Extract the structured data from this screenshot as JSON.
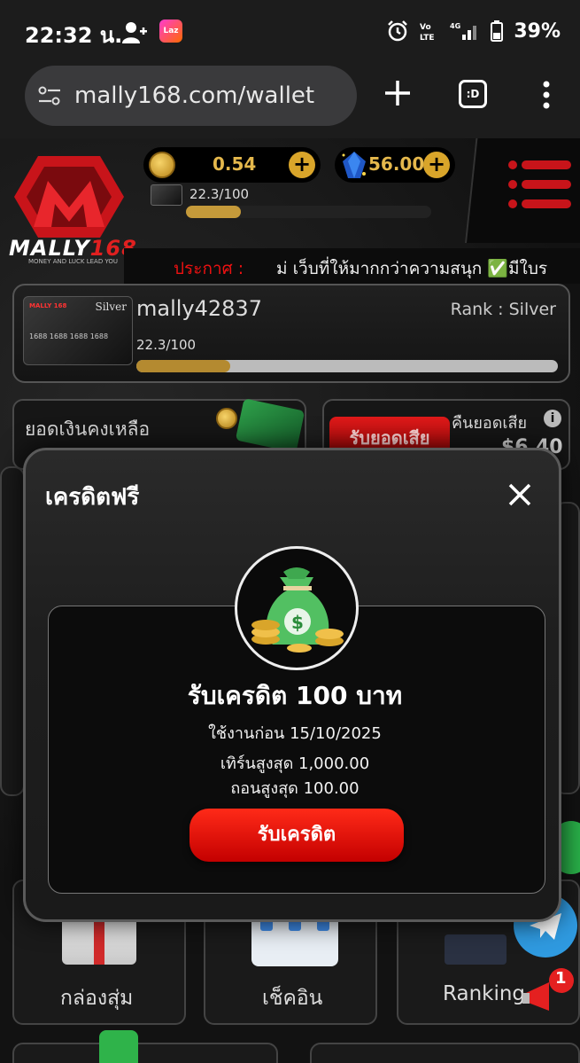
{
  "status_bar": {
    "time": "22:32 น.",
    "battery": "39%",
    "laz_badge": "Laz"
  },
  "browser": {
    "url": "mally168.com/wallet",
    "tab_icon_label": ":D"
  },
  "header": {
    "logo_text_main": "MALLY",
    "logo_text_num": "168",
    "logo_tagline": "MONEY AND LUCK LEAD YOU",
    "coin_balance": "0.54",
    "gem_balance": "56.00",
    "xp_text": "22.3/100",
    "xp_progress": 0.223,
    "announce_label": "ประกาศ :",
    "announce_text": "ม่ เว็บที่ให้มากกว่าความสนุก ✅มีใบร"
  },
  "profile": {
    "card_label": "Silver",
    "card_brand": "MALLY 168",
    "card_numbers": "1688  1688  1688  1688",
    "username": "mally42837",
    "rank": "Rank : Silver",
    "xp_text": "22.3/100",
    "xp_progress": 0.223
  },
  "balance_card": {
    "label": "ยอดเงินคงเหลือ"
  },
  "cashback_card": {
    "tag": "รับยอดเสีย",
    "label": "คืนยอดเสีย",
    "value": "$6.40"
  },
  "modal": {
    "title": "เครดิตฟรี",
    "credit_title": "รับเครดิต 100 บาท",
    "use_before": "ใช้งานก่อน 15/10/2025",
    "max_turnover": "เทิร์นสูงสุด 1,000.00",
    "max_withdraw": "ถอนสูงสุด 100.00",
    "button_label": "รับเครดิต"
  },
  "bottom_tiles": {
    "random_box": "กล่องสุ่ม",
    "check_in": "เช็คอิน",
    "ranking": "Ranking",
    "notification_count": "1"
  }
}
